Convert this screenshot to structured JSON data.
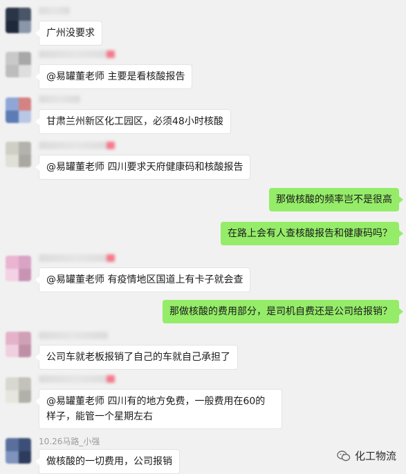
{
  "messages": [
    {
      "side": "left",
      "sender_blurred": true,
      "text": "广州没要求",
      "avatar_colors": [
        "#2a3548",
        "#4a5568",
        "#1e293b",
        "#8a97a8"
      ]
    },
    {
      "side": "left",
      "sender_blurred": true,
      "text": "@易罐董老师 主要是看核酸报告",
      "avatar_colors": [
        "#c9c9c9",
        "#a8a8a8",
        "#bdbdbd",
        "#dedede"
      ]
    },
    {
      "side": "left",
      "sender_blurred": true,
      "text": "甘肃兰州新区化工园区，必须48小时核酸",
      "avatar_colors": [
        "#8fa7d6",
        "#d48282",
        "#5d7bb5",
        "#b9c7e6"
      ]
    },
    {
      "side": "left",
      "sender_blurred": true,
      "text": "@易罐董老师 四川要求天府健康码和核酸报告",
      "avatar_colors": [
        "#cfcfc6",
        "#b3b3ad",
        "#e0e0d8",
        "#a9a9a2"
      ]
    },
    {
      "side": "right",
      "text": "那做核酸的频率岂不是很高"
    },
    {
      "side": "right",
      "text": "在路上会有人查核酸报告和健康码吗？"
    },
    {
      "side": "left",
      "sender_blurred": true,
      "text": "@易罐董老师 有疫情地区国道上有卡子就会查",
      "avatar_colors": [
        "#e9b5d0",
        "#d8a3c4",
        "#f2d2e4",
        "#c993b3"
      ]
    },
    {
      "side": "right",
      "text": "那做核酸的费用部分，是司机自费还是公司给报销？"
    },
    {
      "side": "left",
      "sender_blurred": true,
      "text": "公司车就老板报销了自己的车就自己承担了",
      "avatar_colors": [
        "#e4b3c9",
        "#cfa0b6",
        "#f0d0de",
        "#bf8fa6"
      ]
    },
    {
      "side": "left",
      "sender_blurred": true,
      "text": "@易罐董老师 四川有的地方免费，一般费用在60的样子，能管一个星期左右",
      "avatar_colors": [
        "#d8d8d0",
        "#c2c2ba",
        "#e6e6de",
        "#b1b1aa"
      ]
    },
    {
      "side": "left",
      "sender_blurred": false,
      "sender": "10.26马路_小强",
      "text": "做核酸的一切费用，公司报销",
      "avatar_colors": [
        "#5a6f9c",
        "#3d4f78",
        "#7f93bd",
        "#2d3b5c"
      ]
    }
  ],
  "watermark": {
    "text": "化工物流",
    "icon": "wechat-official-account-icon"
  }
}
